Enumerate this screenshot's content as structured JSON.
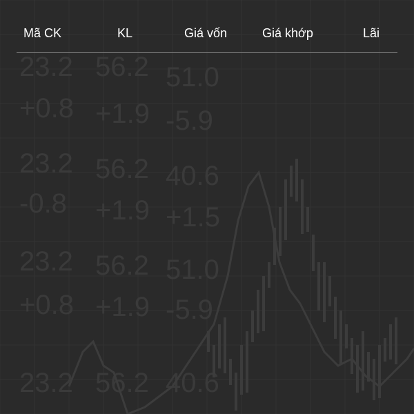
{
  "header": {
    "columns": [
      {
        "label": "Mã CK"
      },
      {
        "label": "KL"
      },
      {
        "label": "Giá vốn"
      },
      {
        "label": "Giá khớp"
      },
      {
        "label": "Lãi"
      }
    ]
  },
  "background": {
    "rows": [
      [
        "23.2",
        "56.2",
        "51.0"
      ],
      [
        "+0.8",
        "+1.9",
        "-5.9"
      ],
      [
        "23.2",
        "56.2",
        "40.6"
      ],
      [
        "-0.8",
        "+1.9",
        "+1.5"
      ],
      [
        "23.2",
        "56.2",
        "51.0"
      ],
      [
        "+0.8",
        "+1.9",
        "-5.9"
      ],
      [
        "23.2",
        "56.2",
        "40.6"
      ]
    ],
    "colors": {
      "background": "#2a2a2a",
      "grid": "#333333",
      "numbers": "#3a3a3a",
      "candles": "#3c3c3c"
    }
  }
}
